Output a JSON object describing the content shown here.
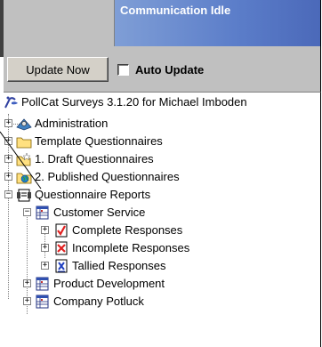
{
  "status": {
    "text": "Communication Idle"
  },
  "toolbar": {
    "update_label": "Update Now",
    "auto_update_label": "Auto Update",
    "auto_update_checked": false
  },
  "tree": {
    "root": "PollCat Surveys 3.1.20 for Michael Imboden",
    "items": {
      "administration": "Administration",
      "templates": "Template Questionnaires",
      "draft": "1. Draft Questionnaires",
      "published": "2. Published Questionnaires",
      "reports": "Questionnaire Reports",
      "customer_service": "Customer Service",
      "complete": "Complete Responses",
      "incomplete": "Incomplete Responses",
      "tallied": "Tallied Responses",
      "product_dev": "Product Development",
      "potluck": "Company Potluck"
    }
  }
}
